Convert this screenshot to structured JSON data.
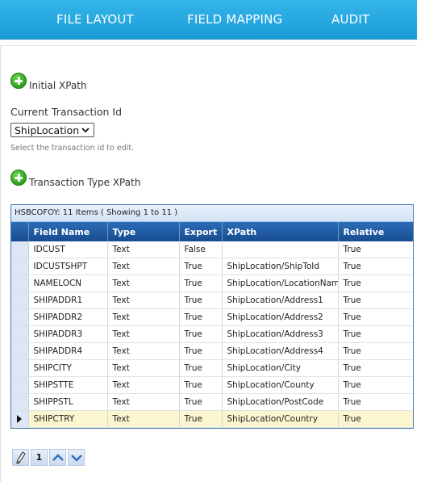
{
  "nav": {
    "tabs": [
      {
        "label": "FILE LAYOUT"
      },
      {
        "label": "FIELD MAPPING"
      },
      {
        "label": "AUDIT"
      }
    ]
  },
  "initial_xpath": {
    "label": "Initial XPath",
    "icon": "plus-circle-icon"
  },
  "transaction": {
    "label": "Current Transaction Id",
    "selected": "ShipLocation",
    "hint": "Select the transaction id to edit."
  },
  "transaction_type_xpath": {
    "label": "Transaction Type XPath",
    "icon": "plus-circle-icon"
  },
  "grid": {
    "caption": "HSBCOFOY: 11 Items ( Showing 1 to 11 )",
    "columns": [
      "Field Name",
      "Type",
      "Export",
      "XPath",
      "Relative"
    ],
    "rows": [
      [
        "IDCUST",
        "Text",
        "False",
        "",
        "True"
      ],
      [
        "IDCUSTSHPT",
        "Text",
        "True",
        "ShipLocation/ShipToId",
        "True"
      ],
      [
        "NAMELOCN",
        "Text",
        "True",
        "ShipLocation/LocationName",
        "True"
      ],
      [
        "SHIPADDR1",
        "Text",
        "True",
        "ShipLocation/Address1",
        "True"
      ],
      [
        "SHIPADDR2",
        "Text",
        "True",
        "ShipLocation/Address2",
        "True"
      ],
      [
        "SHIPADDR3",
        "Text",
        "True",
        "ShipLocation/Address3",
        "True"
      ],
      [
        "SHIPADDR4",
        "Text",
        "True",
        "ShipLocation/Address4",
        "True"
      ],
      [
        "SHIPCITY",
        "Text",
        "True",
        "ShipLocation/City",
        "True"
      ],
      [
        "SHIPSTTE",
        "Text",
        "True",
        "ShipLocation/County",
        "True"
      ],
      [
        "SHIPPSTL",
        "Text",
        "True",
        "ShipLocation/PostCode",
        "True"
      ],
      [
        "SHIPCTRY",
        "Text",
        "True",
        "ShipLocation/Country",
        "True"
      ]
    ],
    "current_row": 10
  },
  "pager": {
    "page": "1",
    "icons": [
      "pencil-icon",
      "chevron-up-icon",
      "chevron-down-icon"
    ]
  },
  "colors": {
    "nav": "#1c9bd8",
    "grid_header": "#174c8e",
    "current_row": "#fbf6cf",
    "add_icon": "#2c9f1d"
  }
}
